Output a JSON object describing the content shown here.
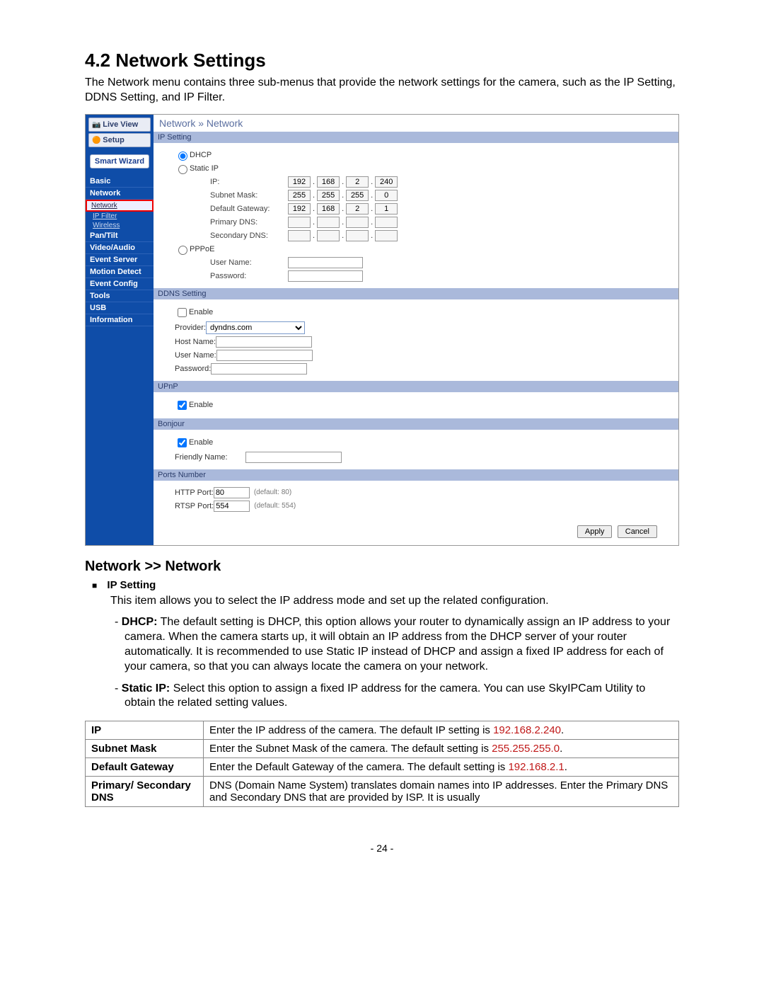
{
  "heading": "4.2  Network Settings",
  "intro": "The Network menu contains three sub-menus that provide the network settings for the camera, such as the IP Setting, DDNS Setting, and IP Filter.",
  "sidebar": {
    "live": "Live View",
    "setup": "Setup",
    "smart": "Smart Wizard",
    "items": [
      {
        "label": "Basic"
      },
      {
        "label": "Network",
        "subs": [
          {
            "label": "Network",
            "hl": true
          },
          {
            "label": "IP Filter"
          },
          {
            "label": "Wireless"
          }
        ]
      },
      {
        "label": "Pan/Tilt"
      },
      {
        "label": "Video/Audio"
      },
      {
        "label": "Event Server"
      },
      {
        "label": "Motion Detect"
      },
      {
        "label": "Event Config"
      },
      {
        "label": "Tools"
      },
      {
        "label": "USB"
      },
      {
        "label": "Information"
      }
    ]
  },
  "breadcrumb": "Network » Network",
  "ipSetting": {
    "header": "IP Setting",
    "dhcp": "DHCP",
    "static": "Static IP",
    "ipLabel": "IP:",
    "ip": [
      "192",
      "168",
      "2",
      "240"
    ],
    "subnetLabel": "Subnet Mask:",
    "subnet": [
      "255",
      "255",
      "255",
      "0"
    ],
    "gwLabel": "Default Gateway:",
    "gw": [
      "192",
      "168",
      "2",
      "1"
    ],
    "pDnsLabel": "Primary DNS:",
    "sDnsLabel": "Secondary DNS:",
    "pppoe": "PPPoE",
    "userLabel": "User Name:",
    "passLabel": "Password:"
  },
  "ddns": {
    "header": "DDNS Setting",
    "enable": "Enable",
    "providerLabel": "Provider:",
    "provider": "dyndns.com",
    "hostLabel": "Host Name:",
    "userLabel": "User Name:",
    "passLabel": "Password:"
  },
  "upnp": {
    "header": "UPnP",
    "enable": "Enable"
  },
  "bonjour": {
    "header": "Bonjour",
    "enable": "Enable",
    "friendlyLabel": "Friendly Name:"
  },
  "ports": {
    "header": "Ports Number",
    "httpLabel": "HTTP Port:",
    "httpVal": "80",
    "httpHint": "(default: 80)",
    "rtspLabel": "RTSP Port:",
    "rtspVal": "554",
    "rtspHint": "(default: 554)"
  },
  "buttons": {
    "apply": "Apply",
    "cancel": "Cancel"
  },
  "below": {
    "subtitle": "Network >> Network",
    "bulletHead": "IP Setting",
    "bulletText": "This item allows you to select the IP address mode and set up the related configuration.",
    "dhcpLead": "DHCP:",
    "dhcpText": " The default setting is DHCP, this option allows your router to dynamically assign an IP address to your camera. When the camera starts up, it will obtain an IP address from the DHCP server of your router automatically.  It is recommended to use Static IP instead of DHCP and assign a fixed IP address for each of your camera, so that you can always locate the camera on your network.",
    "staticLead": "Static IP:",
    "staticText": " Select this option to assign a fixed IP address for the camera. You can use SkyIPCam Utility to obtain the related setting values."
  },
  "table": {
    "rows": [
      {
        "k": "IP",
        "v1": "Enter the IP address of the camera. The default IP setting is ",
        "red": "192.168.2.240",
        "v2": "."
      },
      {
        "k": "Subnet Mask",
        "v1": "Enter the Subnet Mask of the camera. The default setting is ",
        "red": "255.255.255.0",
        "v2": "."
      },
      {
        "k": "Default Gateway",
        "v1": "Enter the Default Gateway of the camera. The default setting is ",
        "red": "192.168.2.1",
        "v2": "."
      },
      {
        "k": "Primary/ Secondary DNS",
        "v1": "DNS (Domain Name System) translates domain names into IP addresses. Enter the Primary DNS and Secondary DNS that are provided by ISP.  It is usually",
        "red": "",
        "v2": ""
      }
    ]
  },
  "footer": "- 24 -"
}
